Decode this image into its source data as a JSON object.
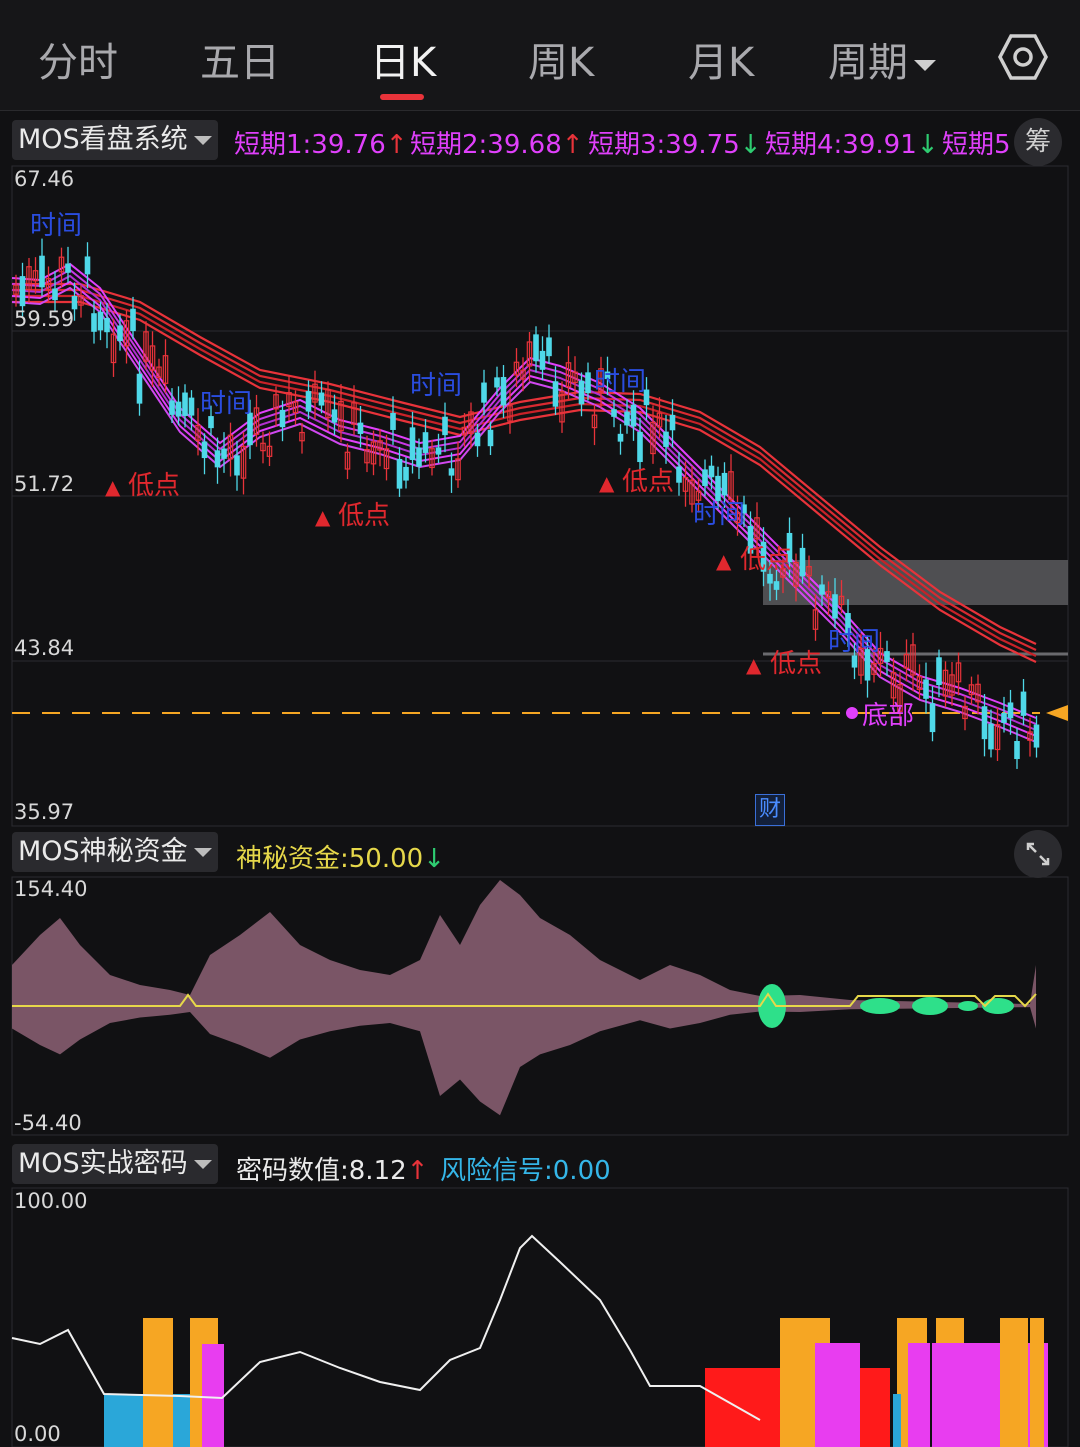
{
  "tabs": [
    {
      "label": "分时",
      "active": false
    },
    {
      "label": "五日",
      "active": false
    },
    {
      "label": "日K",
      "active": true
    },
    {
      "label": "周K",
      "active": false
    },
    {
      "label": "月K",
      "active": false
    },
    {
      "label": "周期",
      "active": false,
      "dropdown": true
    }
  ],
  "settings_icon": "gear-icon",
  "main_panel": {
    "indicator_name": "MOS看盘系统",
    "values": [
      {
        "label": "短期1:39.76",
        "arrow": "↑",
        "arrow_color": "#e8333a"
      },
      {
        "label": "短期2:39.68",
        "arrow": "↑",
        "arrow_color": "#e8333a"
      },
      {
        "label": "短期3:39.75",
        "arrow": "↓",
        "arrow_color": "#2ecc71"
      },
      {
        "label": "短期4:39.91",
        "arrow": "↓",
        "arrow_color": "#2ecc71"
      },
      {
        "label": "短期5",
        "arrow": "",
        "arrow_color": ""
      }
    ],
    "side_button": "筹",
    "y_labels": [
      "67.46",
      "59.59",
      "51.72",
      "43.84",
      "35.97"
    ],
    "annotations": {
      "low_point": "低点",
      "time": "时间",
      "bottom": "底部",
      "cai": "财"
    }
  },
  "fund_panel": {
    "indicator_name": "MOS神秘资金",
    "value_label": "神秘资金:",
    "value": "50.00",
    "arrow": "↓",
    "expand_icon": "expand-icon",
    "y_max": "154.40",
    "y_min": "-54.40"
  },
  "code_panel": {
    "indicator_name": "MOS实战密码",
    "value1_label": "密码数值:",
    "value1": "8.12",
    "value1_arrow": "↑",
    "value2_label": "风险信号:",
    "value2": "0.00",
    "y_max": "100.00",
    "y_min": "0.00"
  },
  "colors": {
    "up": "#e8333a",
    "down": "#4fd8e8",
    "magenta": "#e040fb",
    "yellow": "#e6d84a",
    "orange": "#f6a623"
  }
}
